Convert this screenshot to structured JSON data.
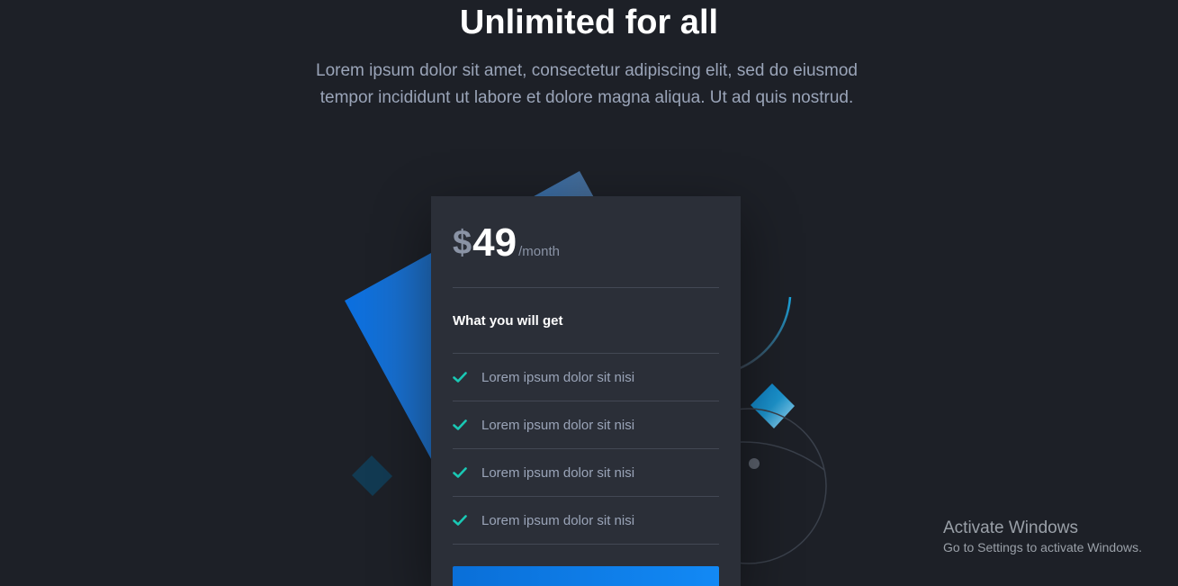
{
  "hero": {
    "title": "Unlimited for all",
    "description": "Lorem ipsum dolor sit amet, consectetur adipiscing elit, sed do eiusmod tempor incididunt ut labore et dolore magna aliqua. Ut ad quis nostrud."
  },
  "pricing": {
    "currency": "$",
    "amount": "49",
    "period": "/month",
    "features_heading": "What you will get",
    "features": [
      {
        "label": "Lorem ipsum dolor sit nisi",
        "icon": "check-icon"
      },
      {
        "label": "Lorem ipsum dolor sit nisi",
        "icon": "check-icon"
      },
      {
        "label": "Lorem ipsum dolor sit nisi",
        "icon": "check-icon"
      },
      {
        "label": "Lorem ipsum dolor sit nisi",
        "icon": "check-icon"
      }
    ],
    "cta_label": ""
  },
  "watermark": {
    "title": "Activate Windows",
    "subtitle": "Go to Settings to activate Windows."
  },
  "colors": {
    "background": "#1d2027",
    "card": "#2b2f38",
    "accent_blue": "#0a75e6",
    "check_teal": "#1ac8b4",
    "muted_text": "#9aa4b8"
  }
}
